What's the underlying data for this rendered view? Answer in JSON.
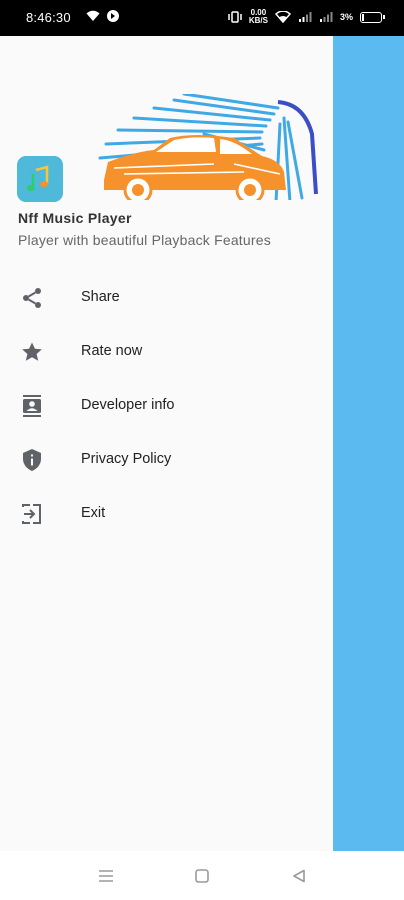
{
  "status_bar": {
    "time": "8:46:30",
    "speed_value": "0.00",
    "speed_unit": "KB/S",
    "battery_pct": "3%"
  },
  "drawer": {
    "app_name": "Nff Music Player",
    "app_tagline": "Player with beautiful Playback Features",
    "menu": [
      {
        "label": "Share",
        "icon": "share-icon"
      },
      {
        "label": "Rate now",
        "icon": "star-icon"
      },
      {
        "label": "Developer info",
        "icon": "contact-card-icon"
      },
      {
        "label": "Privacy Policy",
        "icon": "shield-info-icon"
      },
      {
        "label": "Exit",
        "icon": "exit-icon"
      }
    ]
  },
  "colors": {
    "accent_blue": "#5bbaf0",
    "drawer_bg": "#fafafa",
    "car_orange": "#f5922b",
    "spray_blue": "#3fa9e6",
    "icon_gray": "#5f6368"
  }
}
